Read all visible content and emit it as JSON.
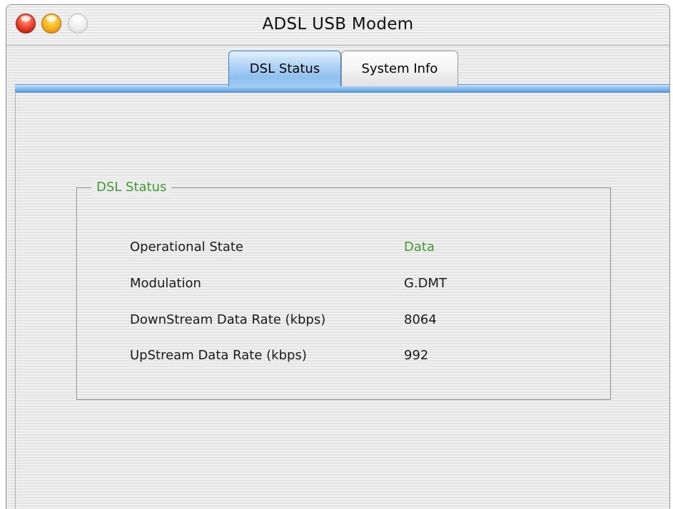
{
  "window": {
    "title": "ADSL USB Modem"
  },
  "tabs": [
    {
      "label": "DSL Status",
      "active": true
    },
    {
      "label": "System Info",
      "active": false
    }
  ],
  "group": {
    "title": "DSL Status",
    "title_color": "#3f9a2e"
  },
  "status_rows": [
    {
      "label": "Operational State",
      "value": "Data",
      "value_color": "#3f9a2e"
    },
    {
      "label": "Modulation",
      "value": "G.DMT"
    },
    {
      "label": "DownStream Data Rate (kbps)",
      "value": "8064"
    },
    {
      "label": "UpStream Data Rate (kbps)",
      "value": "992"
    }
  ],
  "colors": {
    "accent_tab": "#8fc0ee",
    "close_button": "#d52a16",
    "minimize_button": "#f0a010",
    "zoom_button": "#d8d8d8"
  },
  "icons": {
    "close": "close-icon",
    "minimize": "minimize-icon",
    "zoom": "zoom-icon"
  }
}
